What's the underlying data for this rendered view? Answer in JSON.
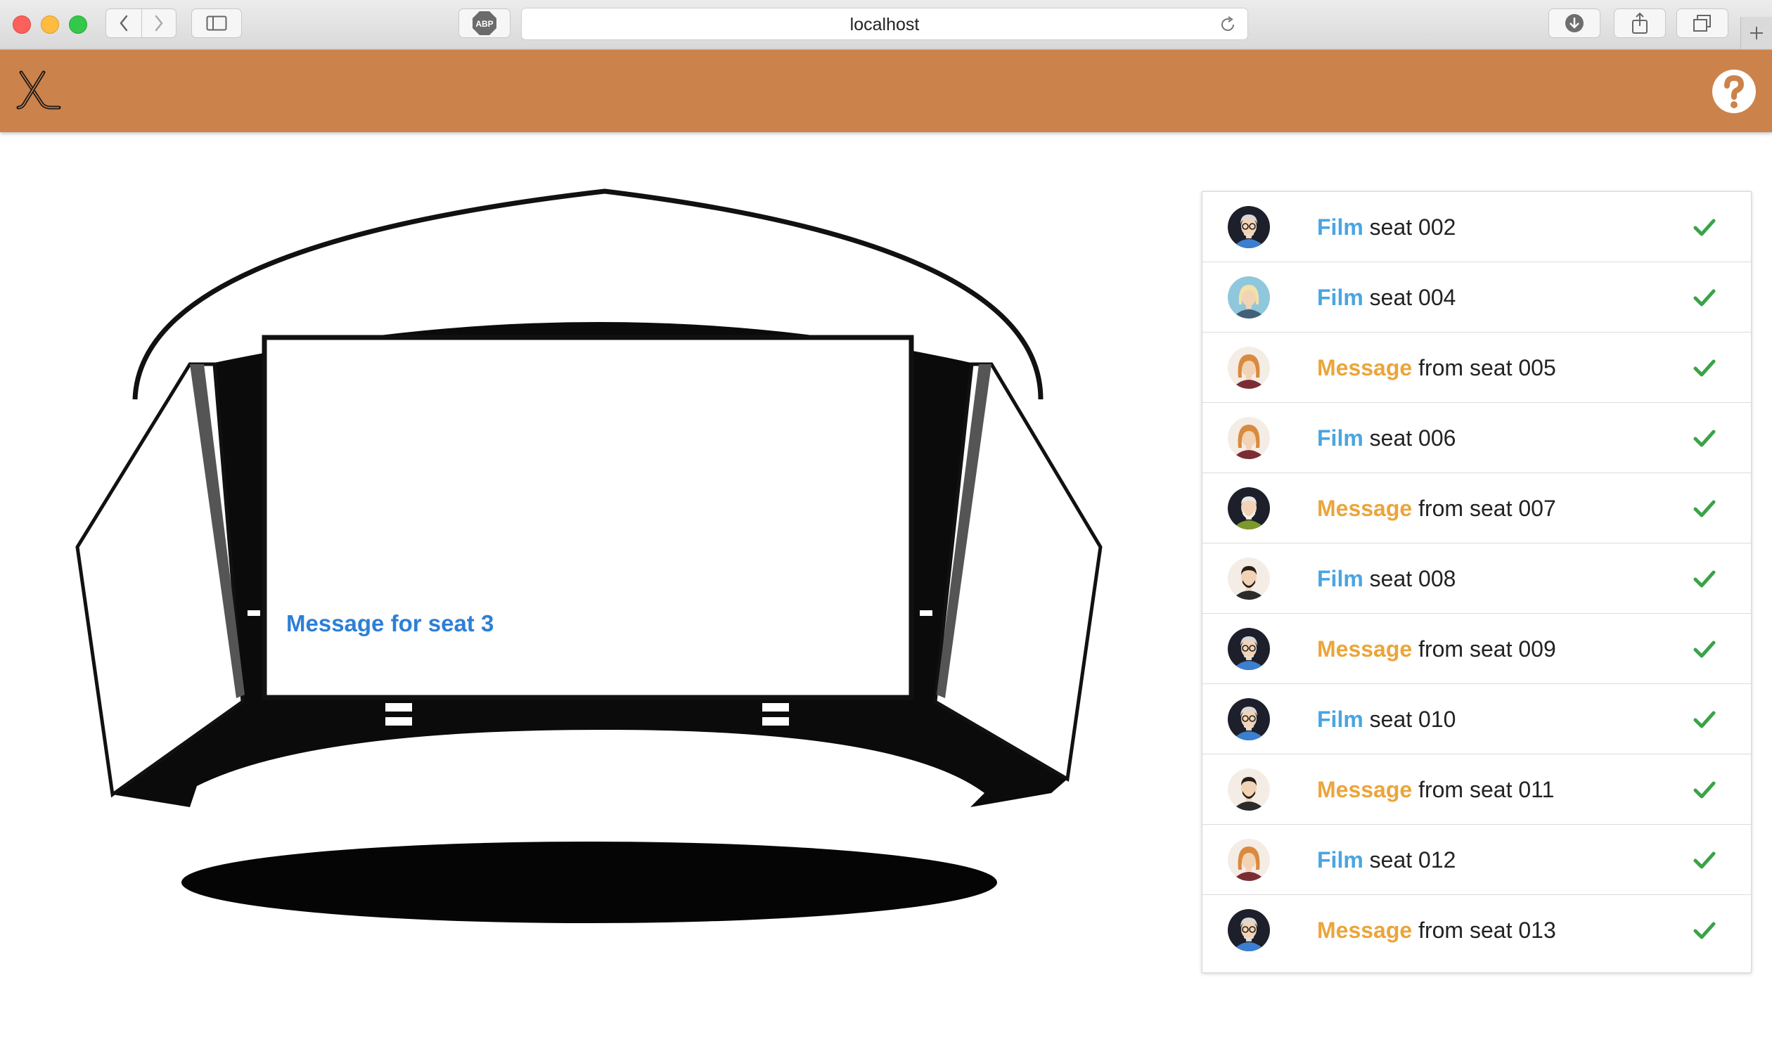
{
  "browser": {
    "url": "localhost",
    "extension_badge": "ABP",
    "icons": [
      "back-icon",
      "forward-icon",
      "sidebar-icon",
      "reload-icon",
      "download-icon",
      "share-icon",
      "tabs-icon",
      "new-tab-icon"
    ]
  },
  "header": {
    "brand_color": "#cc824b",
    "logo_icon": "hockey-sticks-icon",
    "help_icon": "question-icon"
  },
  "stage": {
    "screen_message": "Message for seat 3",
    "message_color": "#2d7fd6"
  },
  "seats": [
    {
      "kind": "Film",
      "rest": "seat 002",
      "avatar": "man-glasses-blue",
      "status": "check-icon"
    },
    {
      "kind": "Film",
      "rest": "seat 004",
      "avatar": "woman-blonde-blue",
      "status": "check-icon"
    },
    {
      "kind": "Message",
      "rest": "from seat 005",
      "avatar": "woman-redhead",
      "status": "check-icon"
    },
    {
      "kind": "Film",
      "rest": "seat 006",
      "avatar": "woman-redhead",
      "status": "check-icon"
    },
    {
      "kind": "Message",
      "rest": "from seat 007",
      "avatar": "man-white-beard",
      "status": "check-icon"
    },
    {
      "kind": "Film",
      "rest": "seat 008",
      "avatar": "man-dark-beard",
      "status": "check-icon"
    },
    {
      "kind": "Message",
      "rest": "from seat 009",
      "avatar": "man-glasses-blue",
      "status": "check-icon"
    },
    {
      "kind": "Film",
      "rest": "seat 010",
      "avatar": "man-glasses-blue",
      "status": "check-icon"
    },
    {
      "kind": "Message",
      "rest": "from seat 011",
      "avatar": "man-dark-beard",
      "status": "check-icon"
    },
    {
      "kind": "Film",
      "rest": "seat 012",
      "avatar": "woman-redhead",
      "status": "check-icon"
    },
    {
      "kind": "Message",
      "rest": "from seat 013",
      "avatar": "man-glasses-blue",
      "status": "check-icon"
    }
  ],
  "colors": {
    "film": "#4aa5e0",
    "message": "#eba53a",
    "check": "#3aa348"
  }
}
